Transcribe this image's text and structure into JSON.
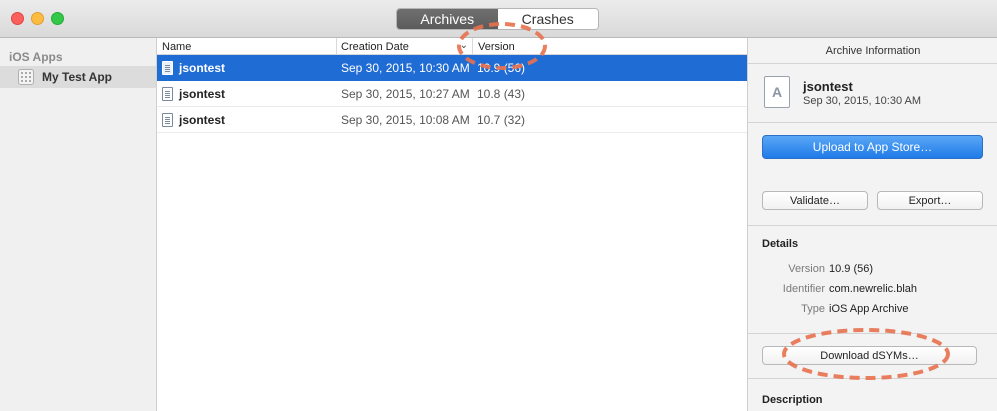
{
  "toolbar": {
    "tabs": [
      {
        "label": "Archives",
        "active": true
      },
      {
        "label": "Crashes",
        "active": false
      }
    ]
  },
  "sidebar": {
    "section_label": "iOS Apps",
    "items": [
      {
        "label": "My Test App",
        "icon": "app-icon",
        "selected": true
      }
    ]
  },
  "table": {
    "columns": [
      {
        "label": "Name"
      },
      {
        "label": "Creation Date",
        "sorted": "descending"
      },
      {
        "label": "Version"
      }
    ],
    "rows": [
      {
        "name": "jsontest",
        "date": "Sep 30, 2015, 10:30 AM",
        "version": "10.9 (56)",
        "selected": true
      },
      {
        "name": "jsontest",
        "date": "Sep 30, 2015, 10:27 AM",
        "version": "10.8 (43)",
        "selected": false
      },
      {
        "name": "jsontest",
        "date": "Sep 30, 2015, 10:08 AM",
        "version": "10.7 (32)",
        "selected": false
      }
    ]
  },
  "inspector": {
    "title": "Archive Information",
    "archive_name": "jsontest",
    "archive_date": "Sep 30, 2015, 10:30 AM",
    "upload_label": "Upload to App Store…",
    "validate_label": "Validate…",
    "export_label": "Export…",
    "details_title": "Details",
    "details": {
      "version_key": "Version",
      "version_value": "10.9 (56)",
      "identifier_key": "Identifier",
      "identifier_value": "com.newrelic.blah",
      "type_key": "Type",
      "type_value": "iOS App Archive"
    },
    "dsyms_label": "Download dSYMs…",
    "description_title": "Description"
  },
  "colors": {
    "selection": "#1f6cd4",
    "primary_button": "#1f7be8",
    "annotation": "#e8714f"
  }
}
